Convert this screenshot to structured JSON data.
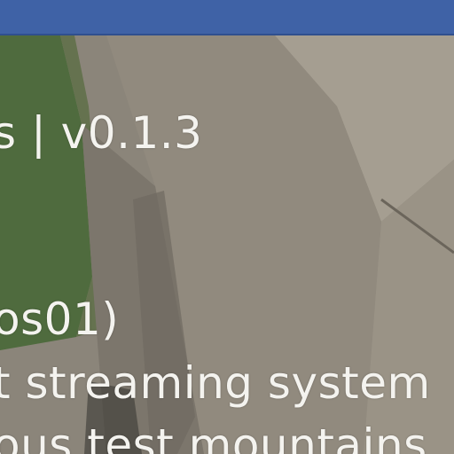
{
  "header": {
    "bar_color": "#3f62a6"
  },
  "overlay": {
    "title": "s | v0.1.3",
    "lines": [
      "os01)",
      "t streaming system",
      "ous test mountains"
    ]
  },
  "scene": {
    "grass_color": "#4f6b3e",
    "rock_color": "#8b857a"
  }
}
